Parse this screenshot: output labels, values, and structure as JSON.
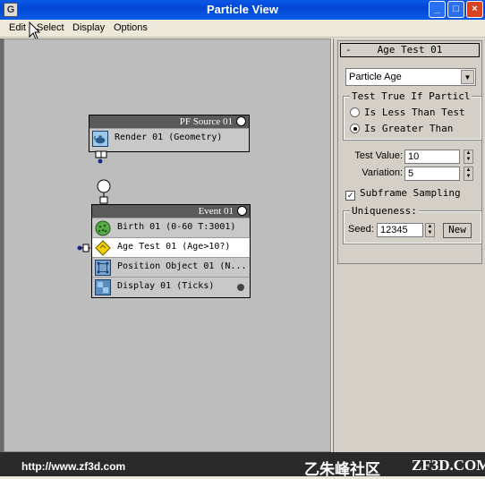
{
  "window": {
    "title": "Particle View",
    "app_icon": "G"
  },
  "menu": [
    "Edit",
    "Select",
    "Display",
    "Options"
  ],
  "nodes": {
    "pf_source": {
      "title": "PF Source 01",
      "rows": [
        "Render 01 (Geometry)"
      ]
    },
    "event": {
      "title": "Event 01",
      "rows": [
        "Birth 01 (0-60 T:3001)",
        "Age Test 01 (Age>10?)",
        "Position Object 01 (N...",
        "Display 01 (Ticks)"
      ]
    }
  },
  "panel": {
    "rollout_title": "Age Test 01",
    "collapse_symbol": "-",
    "test_type": "Particle Age",
    "group_true_legend": "Test True If Particl",
    "radio_less": "Is Less Than Test",
    "radio_greater": "Is Greater Than",
    "test_value_label": "Test Value:",
    "test_value": "10",
    "variation_label": "Variation:",
    "variation": "5",
    "subframe_label": "Subframe Sampling",
    "uniqueness_legend": "Uniqueness:",
    "seed_label": "Seed:",
    "seed": "12345",
    "new_button": "New"
  },
  "footer": {
    "url": "http://www.zf3d.com",
    "brand_cn": "乙朱峰社区",
    "brand_en": "ZF3D.COM"
  },
  "colors": {
    "titlebar": "#0a58e8",
    "canvas": "#bdbdbd",
    "node_header": "#5a5a5a",
    "selection_diamond": "#f4d000"
  }
}
